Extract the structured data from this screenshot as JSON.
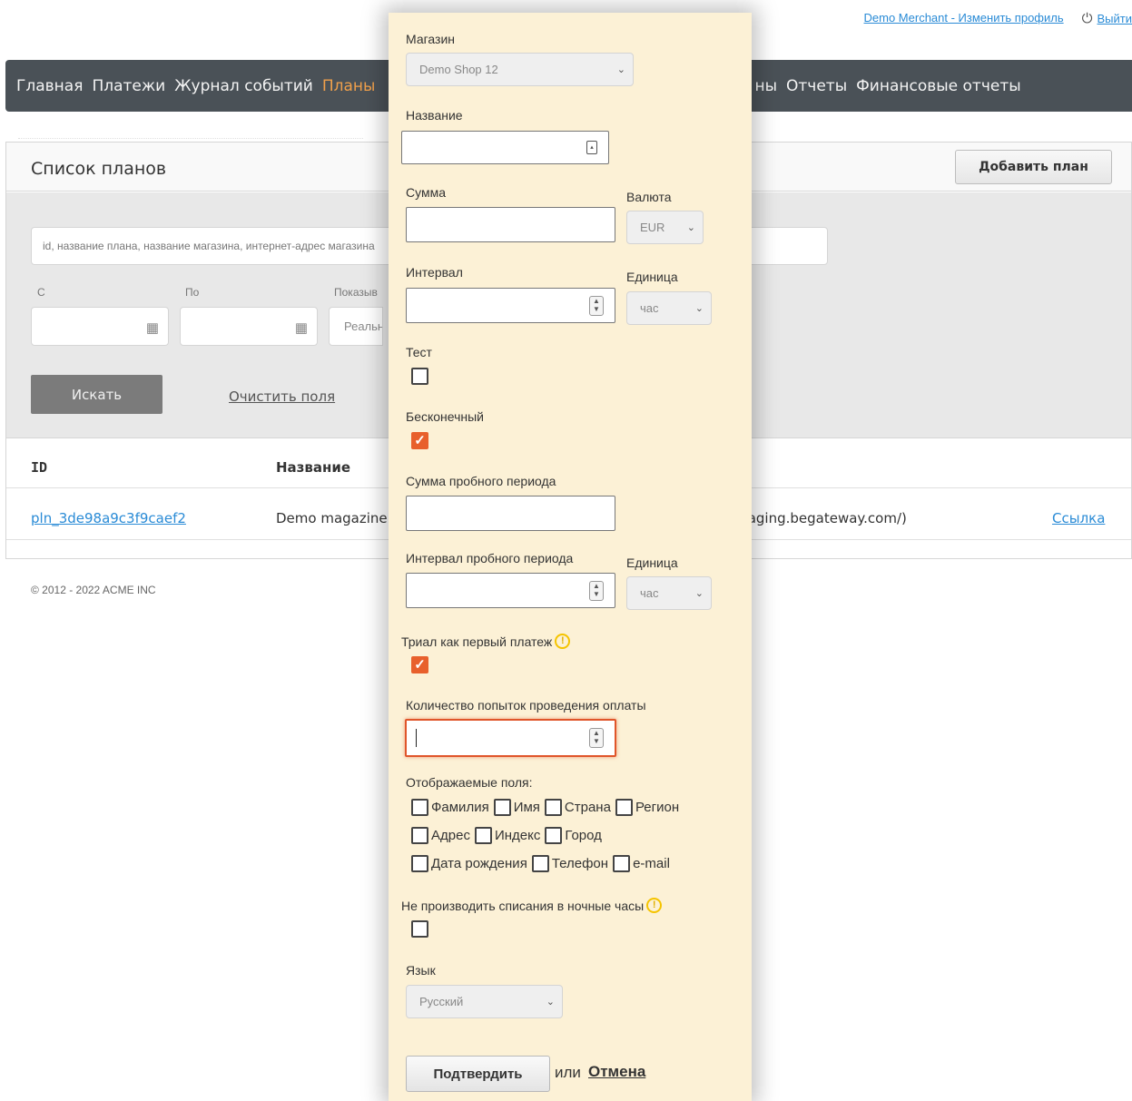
{
  "header": {
    "profile_link": "Demo Merchant - Изменить профиль",
    "logout": "Выйти"
  },
  "nav": {
    "items_left": [
      "Главная",
      "Платежи",
      "Журнал событий"
    ],
    "active": "Планы",
    "items_right": [
      "ны",
      "Отчеты",
      "Финансовые отчеты"
    ]
  },
  "panel": {
    "title": "Список планов",
    "add_button": "Добавить план",
    "search_placeholder": "id, название плана, название магазина, интернет-адрес магазина",
    "from_label": "С",
    "to_label": "По",
    "show_label": "Показыв",
    "show_value": "Реальн",
    "search_button": "Искать",
    "clear_link": "Очистить поля",
    "columns": {
      "id": "ID",
      "name": "Название"
    },
    "rows": [
      {
        "id": "pln_3de98a9c3f9caef2",
        "name": "Demo magazine",
        "shop": "staging.begateway.com/)",
        "link": "Ссылка"
      }
    ]
  },
  "footer": "© 2012 - 2022 ACME INC",
  "form": {
    "shop_label": "Магазин",
    "shop_value": "Demo Shop 12",
    "name_label": "Название",
    "amount_label": "Сумма",
    "currency_label": "Валюта",
    "currency_value": "EUR",
    "interval_label": "Интервал",
    "unit_label": "Единица",
    "unit_value": "час",
    "test_label": "Тест",
    "infinite_label": "Бесконечный",
    "trial_amount_label": "Сумма пробного периода",
    "trial_interval_label": "Интервал пробного периода",
    "trial_unit_label": "Единица",
    "trial_unit_value": "час",
    "trial_first_label": "Триал как первый платеж",
    "attempts_label": "Количество попыток проведения оплаты",
    "fields_label": "Отображаемые поля:",
    "fields_rows": [
      [
        "Фамилия",
        "Имя",
        "Страна",
        "Регион"
      ],
      [
        "Адрес",
        "Индекс",
        "Город"
      ],
      [
        "Дата рождения",
        "Телефон",
        "e-mail"
      ]
    ],
    "no_night_label": "Не производить списания в ночные часы",
    "language_label": "Язык",
    "language_value": "Русский",
    "confirm_button": "Подтвердить",
    "or_text": "или",
    "cancel_link": "Отмена"
  }
}
